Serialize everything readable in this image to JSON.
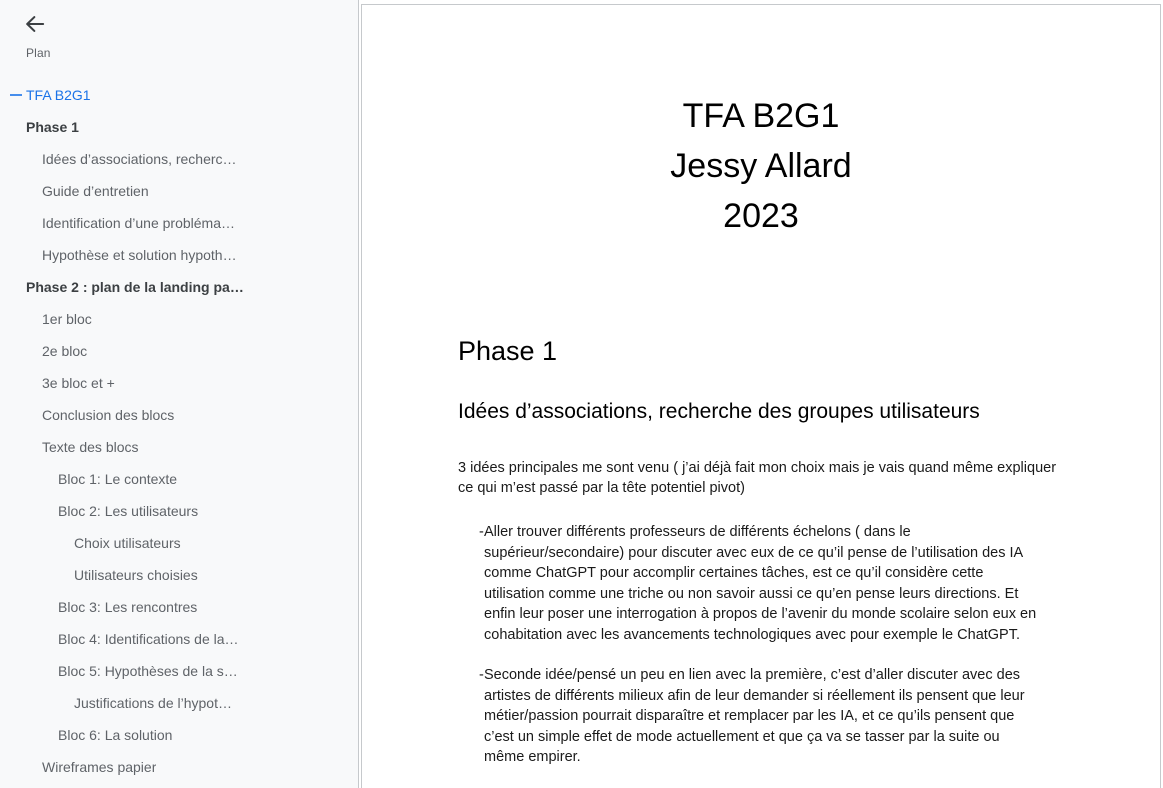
{
  "sidebar": {
    "back_icon": "back-arrow-icon",
    "label": "Plan",
    "collapse_icon": "minus-collapse-icon",
    "accent_color": "#1a73e8",
    "background_color": "#f8f9fa",
    "items": [
      {
        "label": "TFA B2G1",
        "level": "root",
        "has_toggle": true
      },
      {
        "label": "Phase 1",
        "level": "0",
        "has_toggle": false
      },
      {
        "label": "Idées d’associations, recherc…",
        "level": "1",
        "has_toggle": false
      },
      {
        "label": "Guide d’entretien",
        "level": "1",
        "has_toggle": false
      },
      {
        "label": "Identification d’une probléma…",
        "level": "1",
        "has_toggle": false
      },
      {
        "label": "Hypothèse et solution hypoth…",
        "level": "1",
        "has_toggle": false
      },
      {
        "label": "Phase 2 : plan de la landing pa…",
        "level": "0",
        "has_toggle": false
      },
      {
        "label": "1er bloc",
        "level": "1",
        "has_toggle": false
      },
      {
        "label": "2e bloc",
        "level": "1",
        "has_toggle": false
      },
      {
        "label": "3e bloc et +",
        "level": "1",
        "has_toggle": false
      },
      {
        "label": "Conclusion des blocs",
        "level": "1",
        "has_toggle": false
      },
      {
        "label": "Texte des blocs",
        "level": "1",
        "has_toggle": false
      },
      {
        "label": "Bloc 1: Le contexte",
        "level": "2",
        "has_toggle": false
      },
      {
        "label": "Bloc 2: Les utilisateurs",
        "level": "2",
        "has_toggle": false
      },
      {
        "label": "Choix utilisateurs",
        "level": "3",
        "has_toggle": false
      },
      {
        "label": "Utilisateurs choisies",
        "level": "3",
        "has_toggle": false
      },
      {
        "label": "Bloc 3: Les rencontres",
        "level": "2",
        "has_toggle": false
      },
      {
        "label": "Bloc 4: Identifications de la…",
        "level": "2",
        "has_toggle": false
      },
      {
        "label": "Bloc 5: Hypothèses de la s…",
        "level": "2",
        "has_toggle": false
      },
      {
        "label": "Justifications de l’hypot…",
        "level": "3",
        "has_toggle": false
      },
      {
        "label": "Bloc 6: La solution",
        "level": "2",
        "has_toggle": false
      },
      {
        "label": "Wireframes papier",
        "level": "1",
        "has_toggle": false
      }
    ]
  },
  "document": {
    "title_lines": [
      "TFA B2G1",
      "Jessy Allard",
      "2023"
    ],
    "heading1": "Phase 1",
    "heading2": "Idées d’associations, recherche des groupes utilisateurs",
    "intro_paragraph": "3 idées principales me sont venu ( j’ai déjà fait mon choix mais je vais quand même expliquer ce qui m’est passé par la tête potentiel pivot)",
    "bullet_marker": "-",
    "bullets": [
      "Aller trouver différents professeurs de différents échelons  ( dans le supérieur/secondaire) pour discuter avec eux de ce qu’il pense de l’utilisation des IA comme ChatGPT pour accomplir certaines tâches, est ce qu’il considère cette utilisation comme une triche ou non savoir aussi ce qu’en pense leurs directions. Et enfin leur poser une interrogation à propos de l’avenir du monde scolaire selon eux en cohabitation avec les avancements technologiques avec pour exemple le ChatGPT.",
      "Seconde idée/pensé un peu en lien avec la première, c’est d’aller discuter avec des artistes de différents milieux afin de leur demander si réellement ils pensent que leur métier/passion pourrait disparaître et remplacer par les IA, et ce qu’ils pensent que c’est un simple effet de mode actuellement et que ça va se tasser par la suite ou même empirer."
    ]
  }
}
